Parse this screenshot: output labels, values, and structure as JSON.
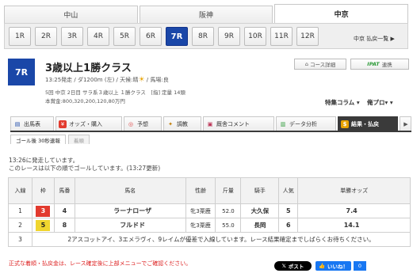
{
  "venues": [
    {
      "label": "中山",
      "active": false
    },
    {
      "label": "阪神",
      "active": false
    },
    {
      "label": "中京",
      "active": true
    }
  ],
  "races": [
    "1R",
    "2R",
    "3R",
    "4R",
    "5R",
    "6R",
    "7R",
    "8R",
    "9R",
    "10R",
    "11R",
    "12R"
  ],
  "active_race": "7R",
  "tokutei_link": "中京 払戻一覧 ▶",
  "race": {
    "number": "7R",
    "name": "3歳以上1勝クラス",
    "meta_prefix": "13:25発走 / ダ1200m (左) / 天候:晴",
    "meta_suffix": " / 馬場:良",
    "info1": "5回 中京 2日目 サラ系３歳以上 １勝クラス　[指] 定量 14頭",
    "info2": "本賞金:800,320,200,120,80万円"
  },
  "course_btn": "コース詳細",
  "ipat_logo": "IPAT",
  "ipat_btn": "連携",
  "tokusyu": "特集コラム ▾",
  "orepro": "俺プロ▾ ▾",
  "menu_tabs": [
    {
      "label": "出馬表",
      "icon": "▤"
    },
    {
      "label": "オッズ・購入",
      "icon": "¥"
    },
    {
      "label": "予想",
      "icon": "◎"
    },
    {
      "label": "調教",
      "icon": "✦"
    },
    {
      "label": "厩舎コメント",
      "icon": "▣"
    },
    {
      "label": "データ分析",
      "icon": "▥"
    },
    {
      "label": "結果・払戻",
      "icon": "$"
    },
    {
      "label": "",
      "icon": "▶"
    }
  ],
  "subtabs": {
    "goal": "ゴール後 30秒速報",
    "kakutei": "着順"
  },
  "notes": [
    "13:26に発走しています。",
    "このレースは以下の順でゴールしています。(13:27更新)"
  ],
  "table": {
    "headers": {
      "rank": "入線",
      "waku": "枠",
      "uma": "馬番",
      "name": "馬名",
      "sexage": "性齢",
      "weight": "斤量",
      "jockey": "騎手",
      "ninki": "人気",
      "odds": "単勝オッズ"
    },
    "rows": [
      {
        "rank": "1",
        "waku": "3",
        "uma": "4",
        "name": "ラーナローザ",
        "sexage": "牝3栗鹿",
        "weight": "52.0",
        "jockey": "大久保",
        "ninki": "5",
        "odds": "7.4"
      },
      {
        "rank": "2",
        "waku": "5",
        "uma": "8",
        "name": "フルドド",
        "sexage": "牝3栗鹿",
        "weight": "55.0",
        "jockey": "長岡",
        "ninki": "6",
        "odds": "14.1"
      }
    ],
    "remark_rank": "3",
    "remark": "2アスコットアイ、3エメラヴィ、9レイムが優差で入線しています。レース結果確定までしばらくお待ちください。"
  },
  "warning": "正式な着順・払戻金は、レース確定後に上部メニューでご確認ください。",
  "x_post": "ポスト",
  "fb_like": "いいね！",
  "fb_count": "0",
  "colors": {
    "accent": "#1a47a8",
    "waku3": "#e23a2e",
    "waku5": "#f0d52e",
    "warning": "#dd2222"
  }
}
